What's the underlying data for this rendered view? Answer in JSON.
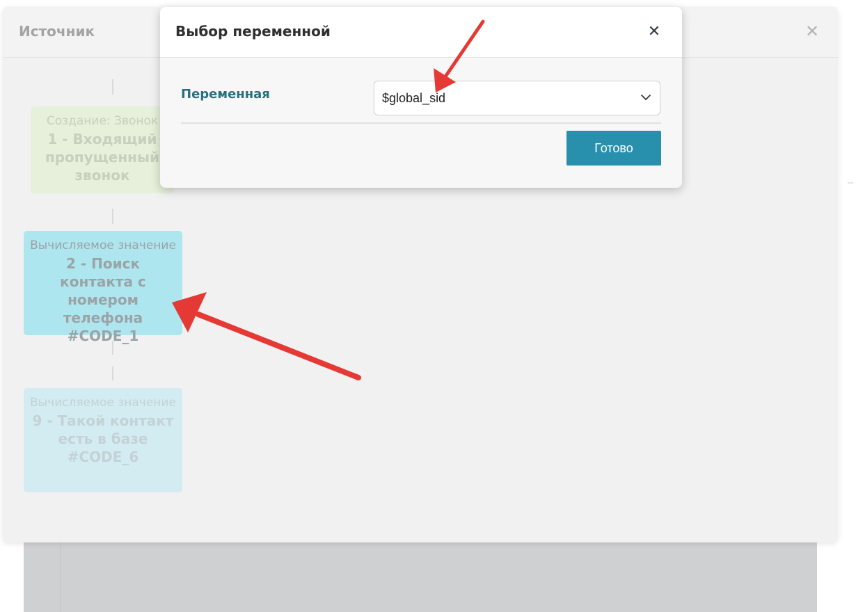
{
  "outer_dialog": {
    "title": "Источник",
    "close_icon": "close-icon"
  },
  "flow_nodes": [
    {
      "type": "Создание: Звонок",
      "name": "1 - Входящий пропущенный звонок"
    },
    {
      "type": "Вычисляемое значение",
      "name": "2 - Поиск контакта с номером телефона #CODE_1"
    },
    {
      "type": "Вычисляемое значение",
      "name": "9 - Такой контакт есть в базе #CODE_6"
    }
  ],
  "modal": {
    "title": "Выбор переменной",
    "close_icon": "close-icon",
    "field_label": "Переменная",
    "select_value": "$global_sid",
    "select_icon": "chevron-down-icon",
    "done_label": "Готово"
  },
  "colors": {
    "accent_button": "#2890ad",
    "label_teal": "#2d6e7e",
    "annotation_red": "#e53935",
    "node_highlight": "#aee6f0"
  }
}
